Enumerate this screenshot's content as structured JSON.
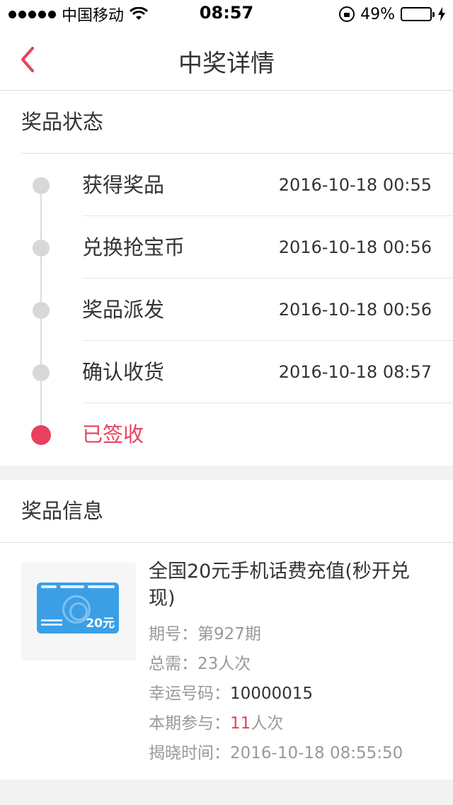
{
  "status_bar": {
    "carrier": "中国移动",
    "time": "08:57",
    "battery_percent": "49%",
    "battery_level": 0.49
  },
  "nav": {
    "title": "中奖详情",
    "back_icon": "chevron-left-icon"
  },
  "prize_status": {
    "section_title": "奖品状态",
    "steps": [
      {
        "label": "获得奖品",
        "time": "2016-10-18 00:55"
      },
      {
        "label": "兑换抢宝币",
        "time": "2016-10-18 00:56"
      },
      {
        "label": "奖品派发",
        "time": "2016-10-18 00:56"
      },
      {
        "label": "确认收货",
        "time": "2016-10-18 08:57"
      },
      {
        "label": "已签收",
        "time": ""
      }
    ]
  },
  "prize_info": {
    "section_title": "奖品信息",
    "name": "全国20元手机话费充值(秒开兑现)",
    "card_value": "20元",
    "period_label": "期号：",
    "period_value": "第927期",
    "total_label": "总需：",
    "total_value": "23人次",
    "lucky_label": "幸运号码：",
    "lucky_value": "10000015",
    "join_label": "本期参与：",
    "join_count": "11",
    "join_unit": "人次",
    "reveal_label": "揭晓时间：",
    "reveal_value": "2016-10-18 08:55:50"
  },
  "colors": {
    "accent": "#e8415d",
    "timeline_dot": "#d8d8d8",
    "card_blue": "#3b9fe6"
  }
}
